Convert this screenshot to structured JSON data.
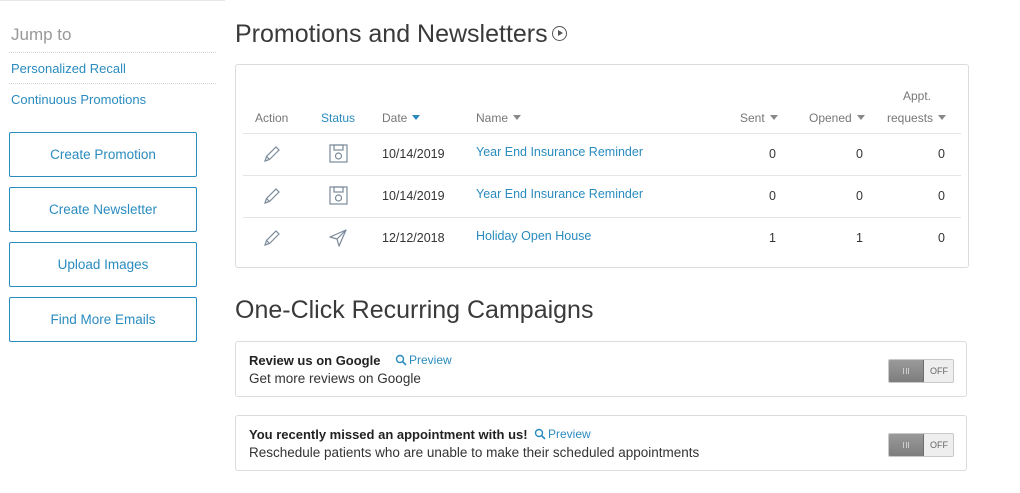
{
  "sidebar": {
    "jump_to": "Jump to",
    "links": [
      "Personalized Recall",
      "Continuous Promotions"
    ],
    "buttons": [
      "Create Promotion",
      "Create Newsletter",
      "Upload Images",
      "Find More Emails"
    ]
  },
  "promotions": {
    "title": "Promotions and Newsletters",
    "columns": {
      "action": "Action",
      "status": "Status",
      "date": "Date",
      "name": "Name",
      "sent": "Sent",
      "opened": "Opened",
      "appt_line1": "Appt.",
      "appt_line2": "requests"
    },
    "rows": [
      {
        "action_icon": "pencil-icon",
        "status_icon": "save-draft-icon",
        "date": "10/14/2019",
        "name": "Year End Insurance Reminder",
        "sent": "0",
        "opened": "0",
        "appt": "0"
      },
      {
        "action_icon": "pencil-icon",
        "status_icon": "save-draft-icon",
        "date": "10/14/2019",
        "name": "Year End Insurance Reminder",
        "sent": "0",
        "opened": "0",
        "appt": "0"
      },
      {
        "action_icon": "pencil-icon",
        "status_icon": "sent-paper-plane-icon",
        "date": "12/12/2018",
        "name": "Holiday Open House",
        "sent": "1",
        "opened": "1",
        "appt": "0"
      }
    ]
  },
  "campaigns": {
    "title": "One-Click Recurring Campaigns",
    "items": [
      {
        "title": "Review us on Google",
        "preview": "Preview",
        "description": "Get more reviews on Google",
        "toggle": "OFF"
      },
      {
        "title": "You recently missed an appointment with us!",
        "preview": "Preview",
        "description": "Reschedule patients who are unable to make their scheduled appointments",
        "toggle": "OFF"
      }
    ]
  },
  "colors": {
    "accent": "#2a8bbf",
    "border": "#dcdcdc"
  }
}
